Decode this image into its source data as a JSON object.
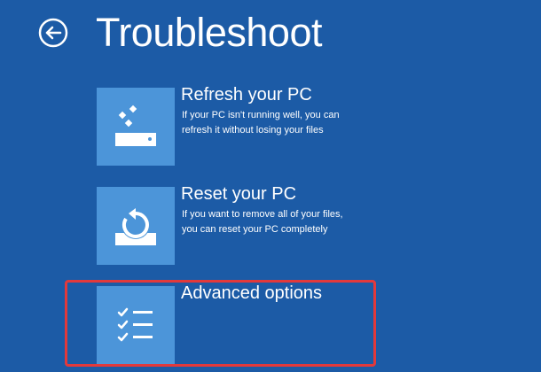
{
  "header": {
    "title": "Troubleshoot",
    "back_icon": "back-arrow-icon"
  },
  "options": [
    {
      "id": "refresh",
      "title": "Refresh your PC",
      "description_lines": [
        "If your PC isn't running well, you can",
        "refresh it without losing your files"
      ],
      "icon": "refresh-pc-icon"
    },
    {
      "id": "reset",
      "title": "Reset your PC",
      "description_lines": [
        "If you want to remove all of your files,",
        "you can reset your PC completely"
      ],
      "icon": "reset-pc-icon"
    },
    {
      "id": "advanced",
      "title": "Advanced options",
      "description_lines": [],
      "icon": "checklist-icon"
    }
  ],
  "colors": {
    "background": "#1c5ba6",
    "tile": "#4c95d9",
    "text": "#ffffff",
    "highlight": "#e2393b"
  }
}
